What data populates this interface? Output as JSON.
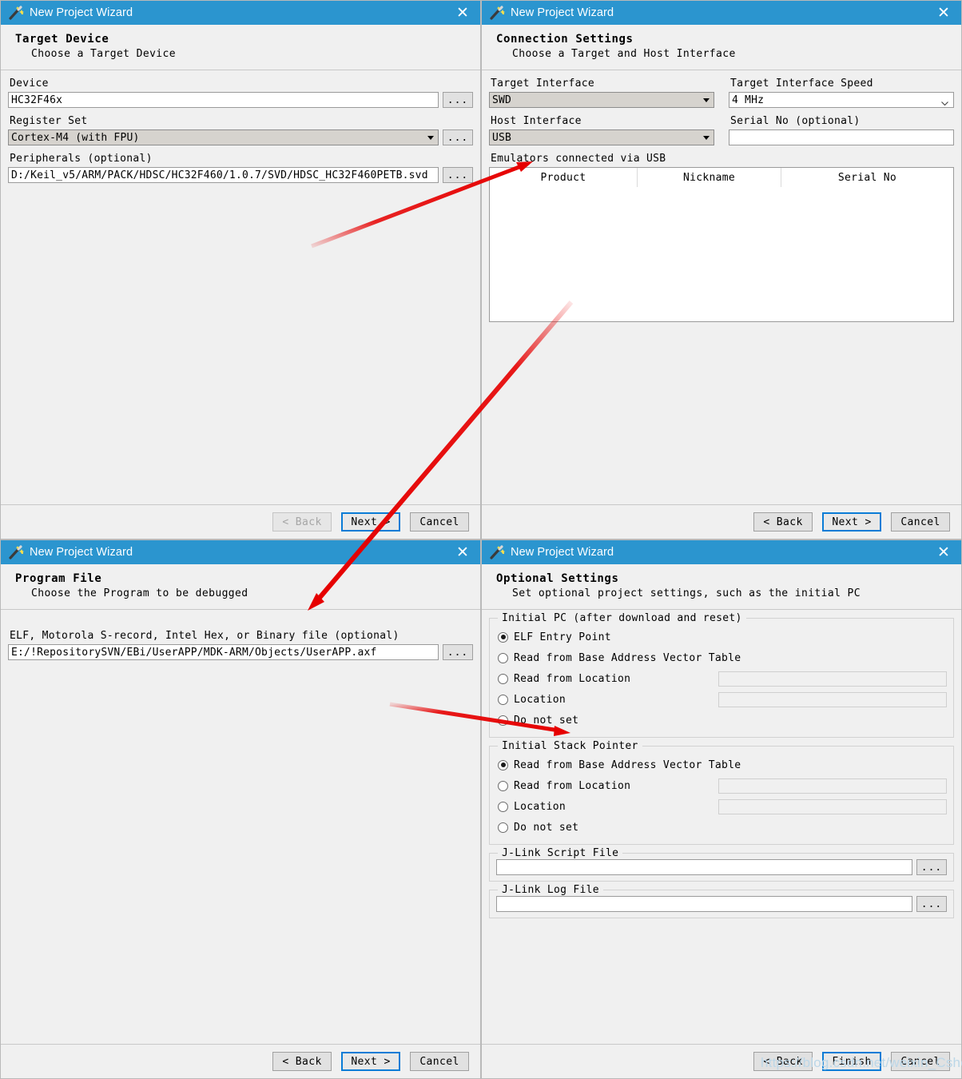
{
  "window_title": "New Project Wizard",
  "icons": {
    "app": "magic-wand-icon",
    "close": "close-icon",
    "dropdown": "triangle-down-icon",
    "combo": "chevron-down-icon",
    "browse": "..."
  },
  "panels": {
    "target_device": {
      "header_title": "Target Device",
      "header_sub": "Choose a Target Device",
      "device_label": "Device",
      "device_value": "HC32F46x",
      "register_set_label": "Register Set",
      "register_set_value": "Cortex-M4 (with FPU)",
      "peripherals_label": "Peripherals (optional)",
      "peripherals_value": "D:/Keil_v5/ARM/PACK/HDSC/HC32F460/1.0.7/SVD/HDSC_HC32F460PETB.svd",
      "browse_label": "...",
      "buttons": {
        "back": "< Back",
        "next": "Next >",
        "cancel": "Cancel"
      }
    },
    "connection_settings": {
      "header_title": "Connection Settings",
      "header_sub": "Choose a Target and Host Interface",
      "target_interface_label": "Target Interface",
      "target_interface_value": "SWD",
      "target_speed_label": "Target Interface Speed",
      "target_speed_value": "4 MHz",
      "host_interface_label": "Host Interface",
      "host_interface_value": "USB",
      "serial_no_label": "Serial No (optional)",
      "serial_no_value": "",
      "emulators_label": "Emulators connected via USB",
      "table_headers": [
        "Product",
        "Nickname",
        "Serial No"
      ],
      "table_rows": [],
      "buttons": {
        "back": "< Back",
        "next": "Next >",
        "cancel": "Cancel"
      }
    },
    "program_file": {
      "header_title": "Program File",
      "header_sub": "Choose the Program to be debugged",
      "file_label": "ELF, Motorola S-record, Intel Hex, or Binary file (optional)",
      "file_value": "E:/!RepositorySVN/EBi/UserAPP/MDK-ARM/Objects/UserAPP.axf",
      "browse_label": "...",
      "buttons": {
        "back": "< Back",
        "next": "Next >",
        "cancel": "Cancel"
      }
    },
    "optional_settings": {
      "header_title": "Optional Settings",
      "header_sub": "Set optional project settings, such as the initial PC",
      "initial_pc": {
        "legend": "Initial PC (after download and reset)",
        "options": [
          {
            "label": "ELF Entry Point",
            "selected": true,
            "has_field": false,
            "field_value": ""
          },
          {
            "label": "Read from Base Address Vector Table",
            "selected": false,
            "has_field": false,
            "field_value": ""
          },
          {
            "label": "Read from Location",
            "selected": false,
            "has_field": true,
            "field_value": ""
          },
          {
            "label": "Location",
            "selected": false,
            "has_field": true,
            "field_value": ""
          },
          {
            "label": "Do not set",
            "selected": false,
            "has_field": false,
            "field_value": ""
          }
        ]
      },
      "initial_sp": {
        "legend": "Initial Stack Pointer",
        "options": [
          {
            "label": "Read from Base Address Vector Table",
            "selected": true,
            "has_field": false,
            "field_value": ""
          },
          {
            "label": "Read from Location",
            "selected": false,
            "has_field": true,
            "field_value": ""
          },
          {
            "label": "Location",
            "selected": false,
            "has_field": true,
            "field_value": ""
          },
          {
            "label": "Do not set",
            "selected": false,
            "has_field": false,
            "field_value": ""
          }
        ]
      },
      "script_file": {
        "legend": "J-Link Script File",
        "value": "",
        "browse_label": "..."
      },
      "log_file": {
        "legend": "J-Link Log File",
        "value": "",
        "browse_label": "..."
      },
      "buttons": {
        "back": "< Back",
        "finish": "Finish",
        "cancel": "Cancel"
      }
    }
  },
  "annotations": {
    "arrow_color": "#e60000",
    "count": 3
  },
  "watermark": "https://blog.csdn.net/weixin_CshouCSDN"
}
